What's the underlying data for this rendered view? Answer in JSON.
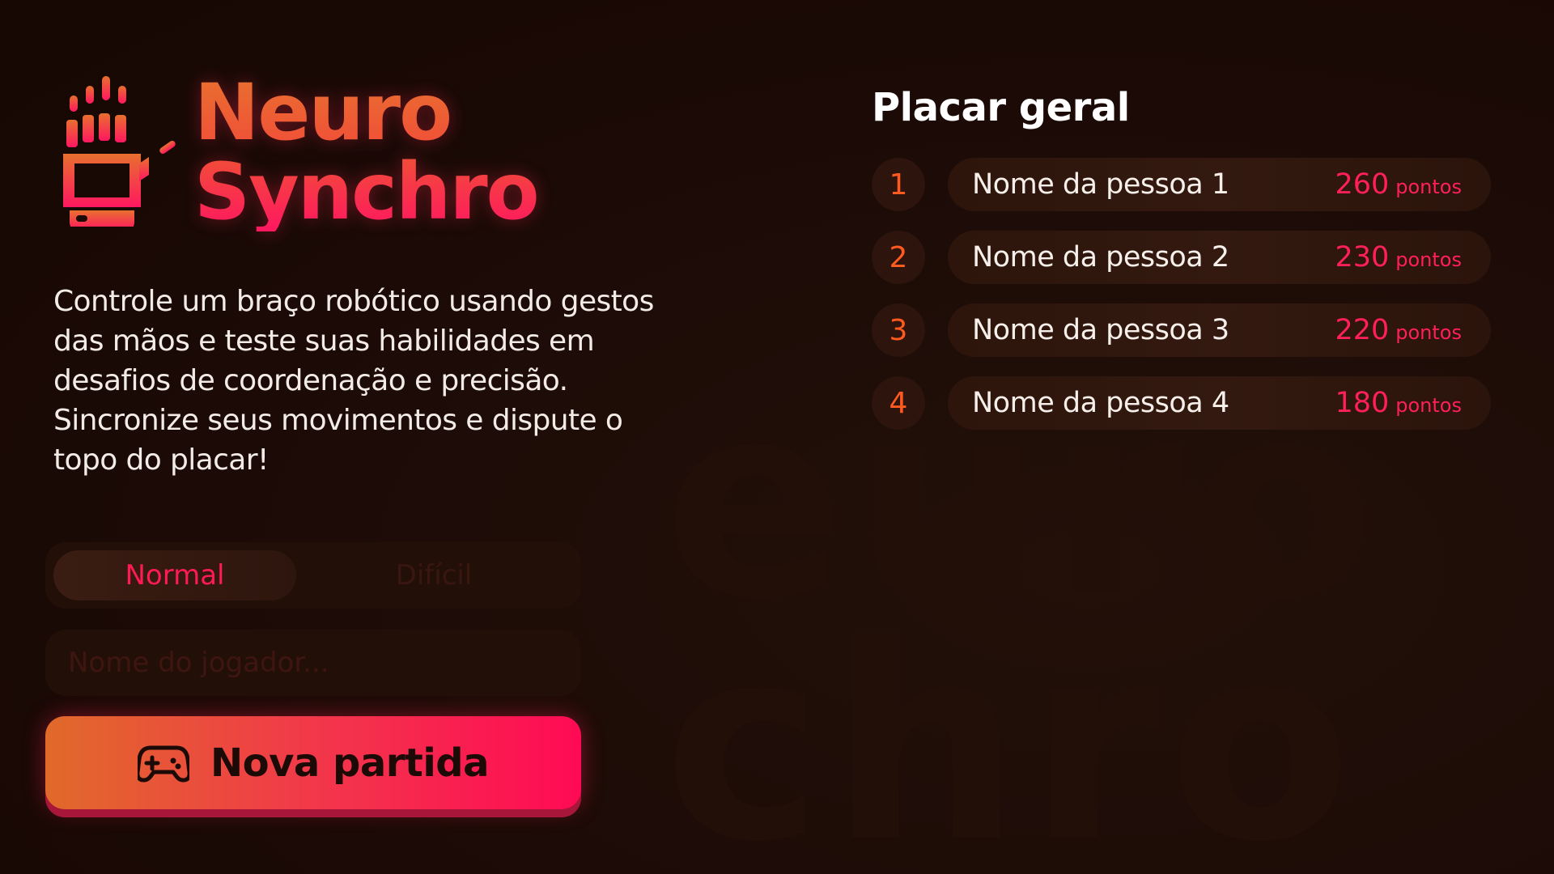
{
  "app": {
    "title_line1": "Neuro",
    "title_line2": "Synchro",
    "description": "Controle um braço robótico usando gestos das mãos e teste suas habilidades em desafios de coordenação e precisão. Sincronize seus movimentos e dispute o topo do placar!",
    "watermark": "euro\nchro",
    "logo_icon": "robotic-hand-icon"
  },
  "difficulty": {
    "options": [
      "Normal",
      "Difícil"
    ],
    "selected": "Normal"
  },
  "player": {
    "placeholder": "Nome do jogador...",
    "value": ""
  },
  "play": {
    "label": "Nova partida",
    "icon": "gamepad-icon"
  },
  "leaderboard": {
    "title": "Placar geral",
    "unit": "pontos",
    "entries": [
      {
        "rank": "1",
        "name": "Nome da pessoa 1",
        "score": "260"
      },
      {
        "rank": "2",
        "name": "Nome da pessoa 2",
        "score": "230"
      },
      {
        "rank": "3",
        "name": "Nome da pessoa 3",
        "score": "220"
      },
      {
        "rank": "4",
        "name": "Nome da pessoa 4",
        "score": "180"
      }
    ]
  },
  "colors": {
    "background": "#1b0a06",
    "accent_orange": "#e06a2a",
    "accent_pink": "#ff0a55",
    "rank_color": "#ff5a1f"
  }
}
